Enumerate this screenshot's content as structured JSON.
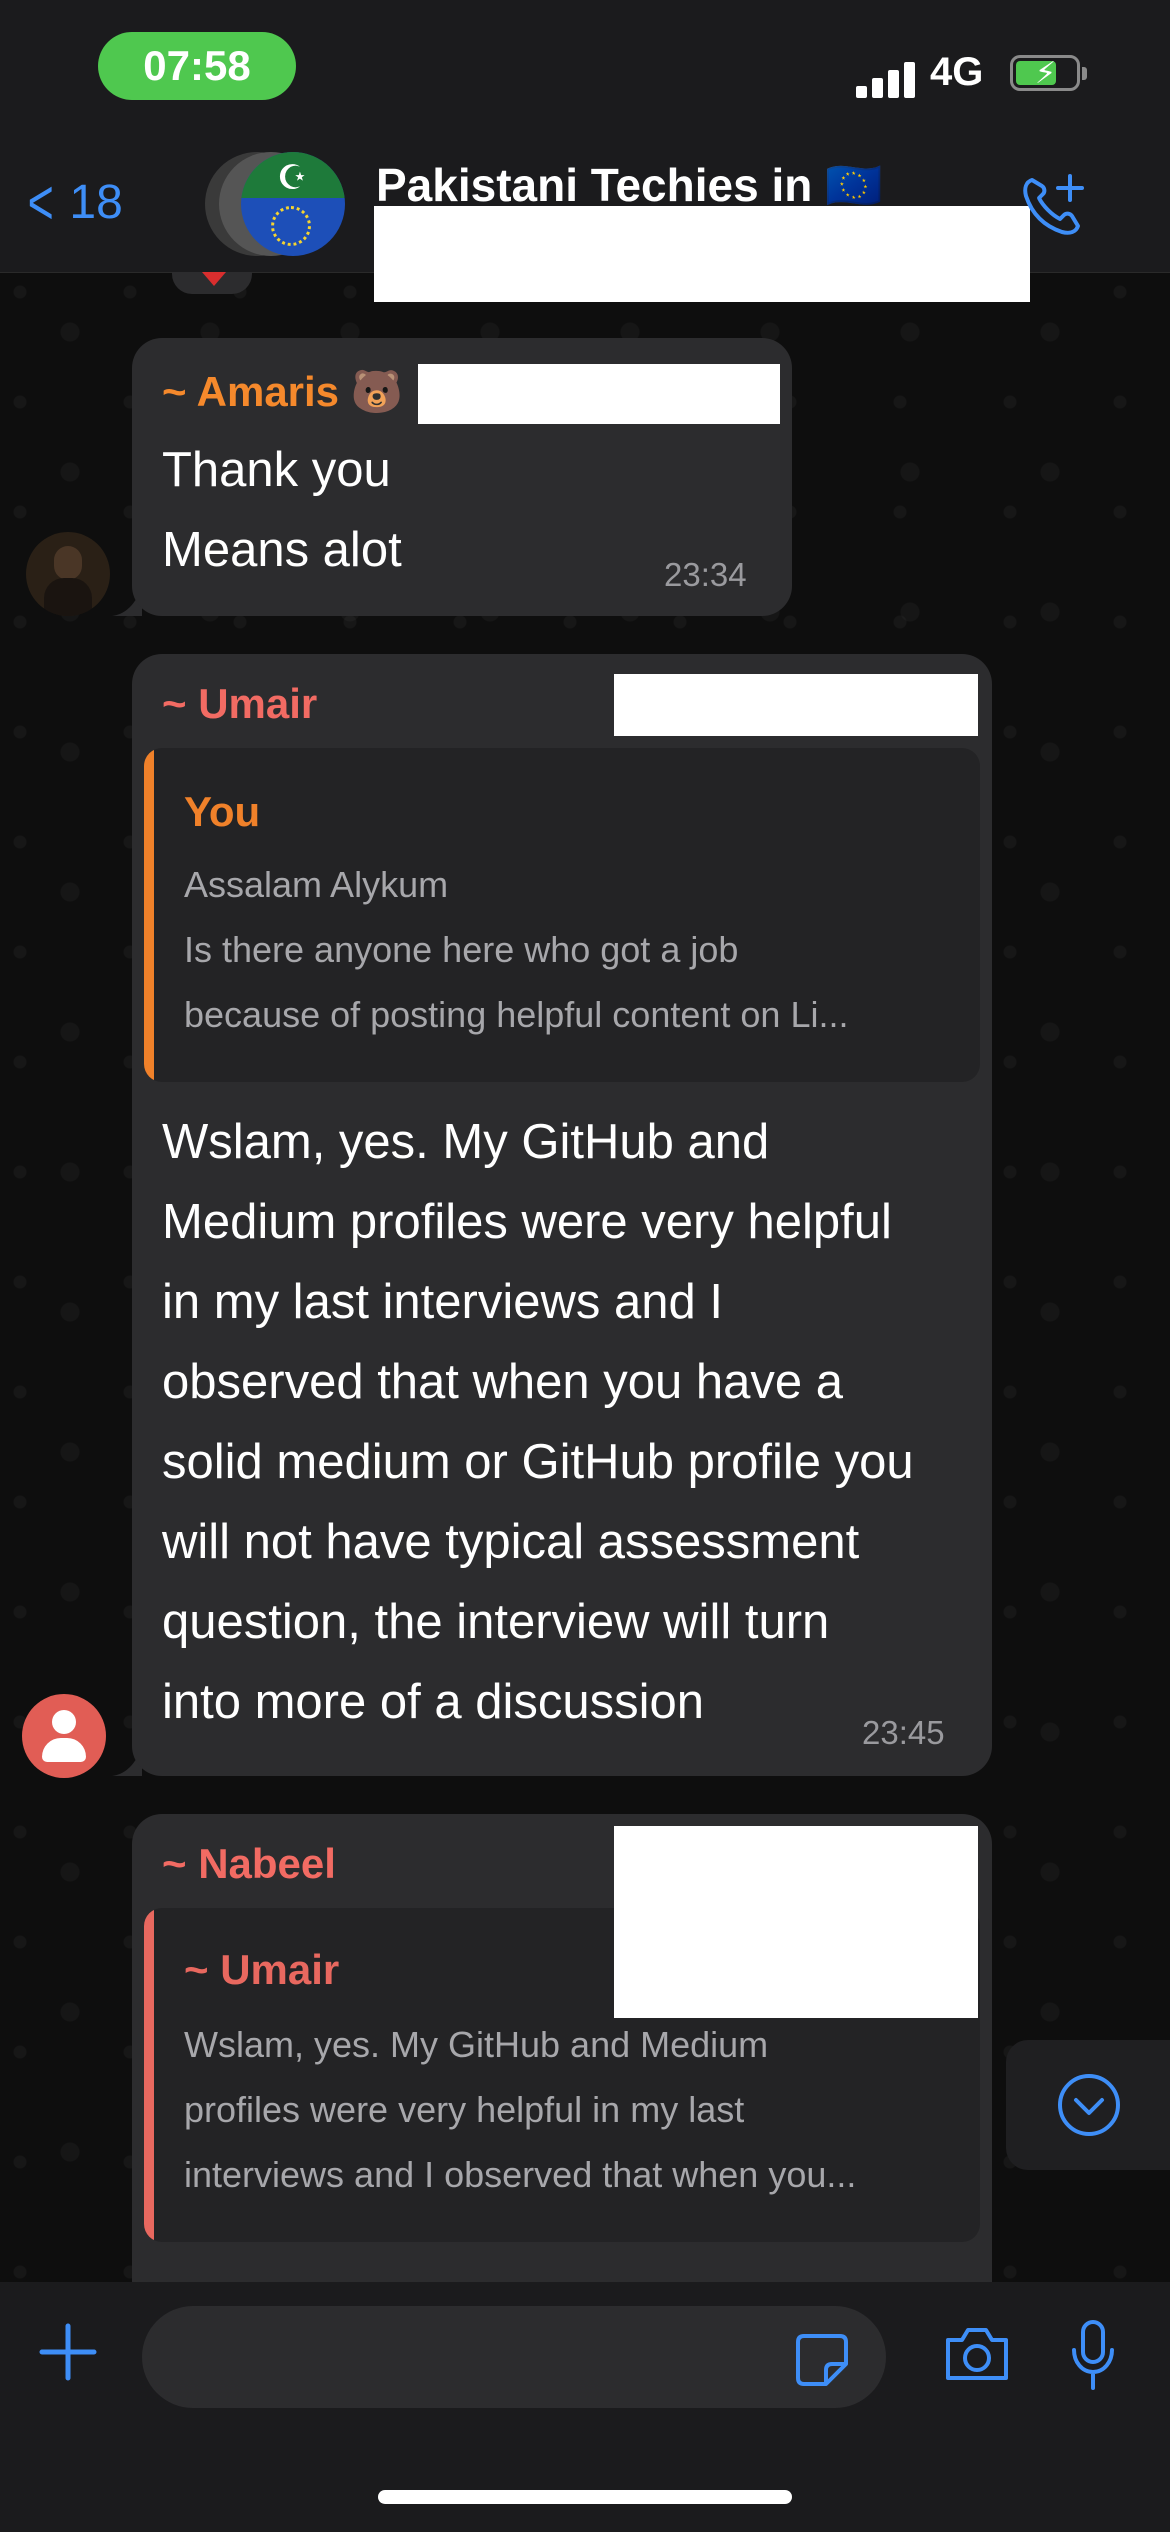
{
  "status_bar": {
    "time": "07:58",
    "network": "4G",
    "battery_charging": true
  },
  "header": {
    "back_count": "18",
    "group_name": "Pakistani Techies in 🇪🇺",
    "call_icon": "phone-plus-icon"
  },
  "messages": [
    {
      "sender": "~ Amaris 🐻",
      "sender_color": "#f5892c",
      "text": "Thank you\nMeans alot",
      "time": "23:34"
    },
    {
      "sender": "~ Umair",
      "sender_color": "#f26b63",
      "quote": {
        "sender": "You",
        "sender_color": "#f0812a",
        "line1": "Assalam Alykum",
        "line2": "Is there anyone here who got a job",
        "line3": "because of posting helpful content on Li..."
      },
      "text": "Wslam, yes. My GitHub and\nMedium profiles were very helpful\nin my last interviews and I\nobserved that when you have a\nsolid medium or GitHub profile you\nwill not have typical assessment\nquestion, the interview will turn\ninto more of a discussion",
      "time": "23:45"
    },
    {
      "sender": "~ Nabeel",
      "sender_color": "#f26b63",
      "quote": {
        "sender": "~ Umair",
        "sender_color": "#e8685f",
        "line1": "Wslam, yes. My GitHub and Medium",
        "line2": "profiles were very helpful in my last",
        "line3": "interviews and I observed that when you..."
      }
    }
  ],
  "composer": {
    "plus_icon": "plus-icon",
    "sticker_icon": "sticker-icon",
    "camera_icon": "camera-icon",
    "mic_icon": "microphone-icon"
  },
  "colors": {
    "accent": "#3e8ef7",
    "bubble": "#2c2c2e",
    "background": "#0b0b0b"
  }
}
